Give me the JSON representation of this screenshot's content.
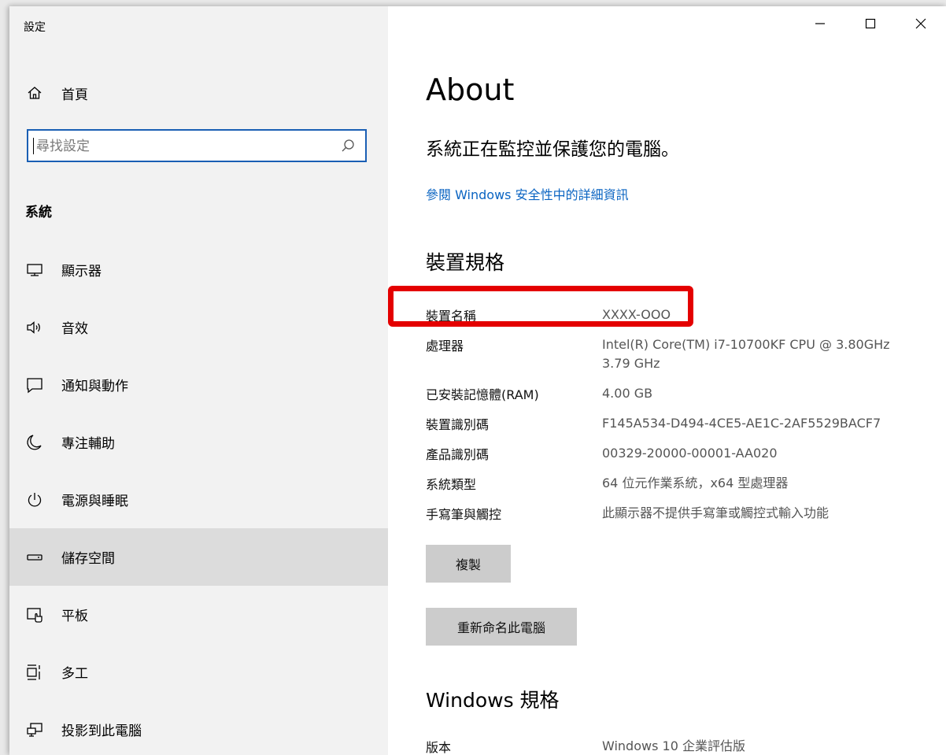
{
  "window": {
    "title": "設定",
    "controls": {
      "minimize": "minimize-icon",
      "maximize": "maximize-icon",
      "close": "close-icon"
    }
  },
  "sidebar": {
    "home_label": "首頁",
    "search_placeholder": "尋找設定",
    "section_heading": "系統",
    "items": [
      {
        "label": "顯示器",
        "icon": "monitor-icon",
        "selected": false
      },
      {
        "label": "音效",
        "icon": "speaker-icon",
        "selected": false
      },
      {
        "label": "通知與動作",
        "icon": "notification-icon",
        "selected": false
      },
      {
        "label": "專注輔助",
        "icon": "moon-icon",
        "selected": false
      },
      {
        "label": "電源與睡眠",
        "icon": "power-icon",
        "selected": false
      },
      {
        "label": "儲存空間",
        "icon": "storage-icon",
        "selected": true
      },
      {
        "label": "平板",
        "icon": "tablet-icon",
        "selected": false
      },
      {
        "label": "多工",
        "icon": "multitask-icon",
        "selected": false
      },
      {
        "label": "投影到此電腦",
        "icon": "project-icon",
        "selected": false
      }
    ]
  },
  "main": {
    "title": "About",
    "status_text": "系統正在監控並保護您的電腦。",
    "security_link": "參閱 Windows 安全性中的詳細資訊",
    "device_specs": {
      "heading": "裝置規格",
      "rows": [
        {
          "label": "裝置名稱",
          "value": "XXXX-OOO"
        },
        {
          "label": "處理器",
          "value": "Intel(R) Core(TM) i7-10700KF CPU @ 3.80GHz",
          "value2": "3.79 GHz"
        },
        {
          "label": "已安裝記憶體(RAM)",
          "value": "4.00 GB"
        },
        {
          "label": "裝置識別碼",
          "value": "F145A534-D494-4CE5-AE1C-2AF5529BACF7"
        },
        {
          "label": "產品識別碼",
          "value": "00329-20000-00001-AA020"
        },
        {
          "label": "系統類型",
          "value": "64 位元作業系統，x64 型處理器"
        },
        {
          "label": "手寫筆與觸控",
          "value": "此顯示器不提供手寫筆或觸控式輸入功能"
        }
      ],
      "copy_button": "複製",
      "rename_button": "重新命名此電腦"
    },
    "windows_specs": {
      "heading": "Windows 規格",
      "rows": [
        {
          "label": "版本",
          "value": "Windows 10 企業評估版"
        }
      ]
    }
  },
  "colors": {
    "accent": "#0a64c2",
    "focus_border": "#1a5fb4",
    "highlight": "#e40000",
    "sidebar_bg": "#f2f2f2",
    "selected_bg": "#dcdcdc",
    "button_bg": "#cccccc"
  }
}
